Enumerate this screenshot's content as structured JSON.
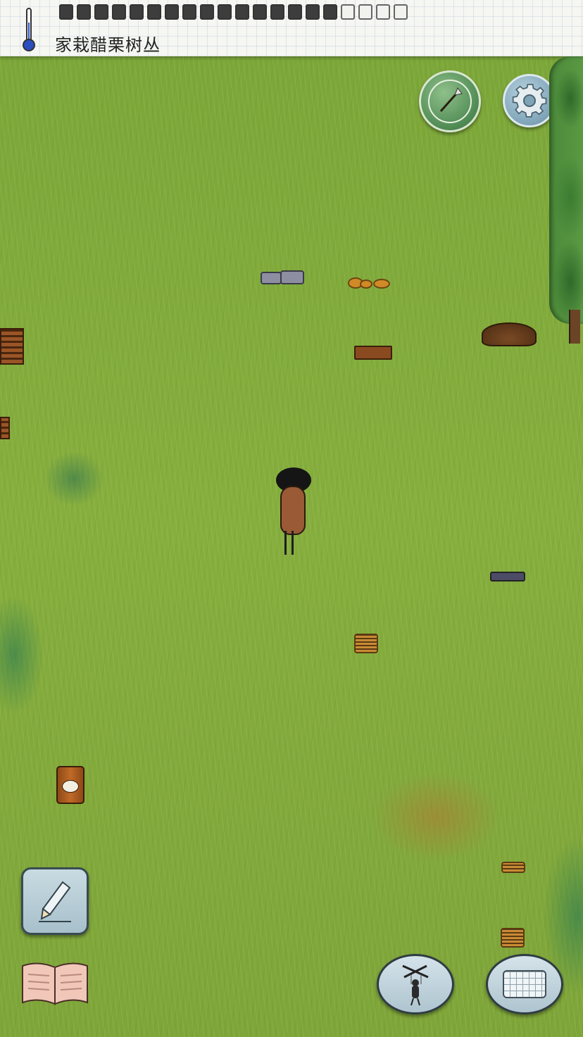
{
  "hud": {
    "tooltip": "家栽醋栗树丛",
    "food_pips": {
      "filled": 16,
      "total": 20
    }
  },
  "icons": {
    "temperature": "thermometer-icon",
    "map": "compass-icon",
    "settings": "gear-icon",
    "write": "pencil-icon",
    "recipes": "book-icon",
    "emote": "puppet-icon",
    "chat": "keyboard-icon"
  },
  "colors": {
    "grass": "#86ae3d",
    "paper": "#f6f6f2",
    "compass_button": "#4f8a54",
    "settings_button": "#7fa4b8"
  }
}
